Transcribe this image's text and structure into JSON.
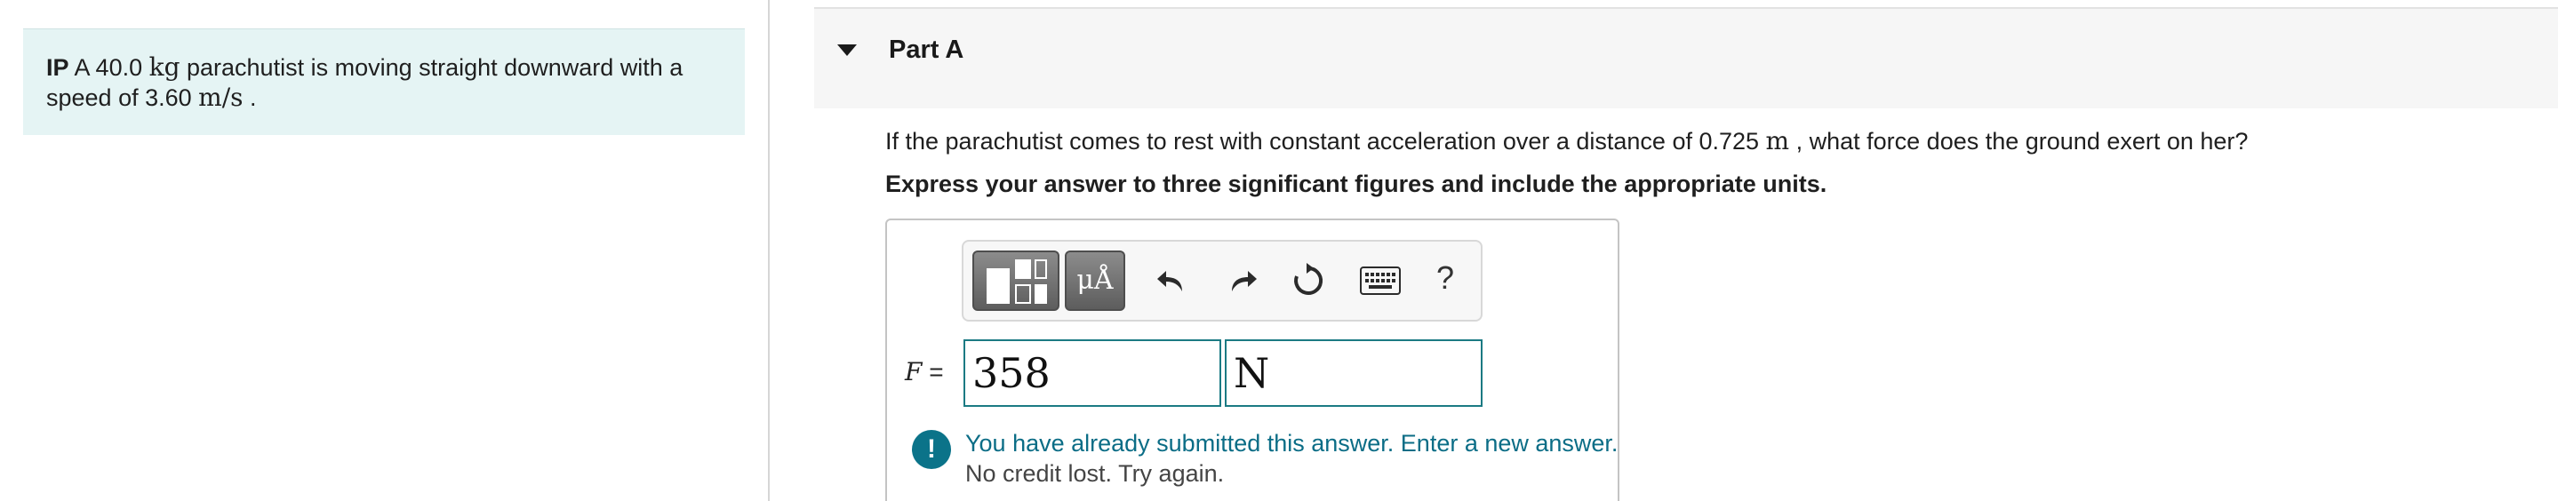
{
  "problem": {
    "prefix": "IP",
    "text_1": " A 40.0 ",
    "unit_1": "kg",
    "text_2": " parachutist is moving straight downward with a speed of 3.60 ",
    "unit_2": "m/s",
    "text_3": " ."
  },
  "part": {
    "title": "Part A"
  },
  "question": {
    "text_1": "If the parachutist comes to rest with constant acceleration over a distance of 0.725 ",
    "unit": "m",
    "text_2": " , what force does the ground exert on her?",
    "instruction": "Express your answer to three significant figures and include the appropriate units."
  },
  "toolbar": {
    "templates_icon": "templates-icon",
    "units_label": "μÅ",
    "undo_icon": "undo-icon",
    "redo_icon": "redo-icon",
    "reset_icon": "reset-icon",
    "keyboard_icon": "keyboard-icon",
    "help_label": "?"
  },
  "answer": {
    "variable": "F",
    "equals": " =",
    "value": "358",
    "units": "N"
  },
  "feedback": {
    "icon": "alert-icon",
    "icon_glyph": "!",
    "message": "You have already submitted this answer. Enter a new answer.",
    "detail": "No credit lost. Try again."
  },
  "colors": {
    "problem_bg": "#e5f4f4",
    "input_border": "#1b7a83",
    "feedback_text": "#0b6d86",
    "feedback_icon": "#0b7389"
  }
}
